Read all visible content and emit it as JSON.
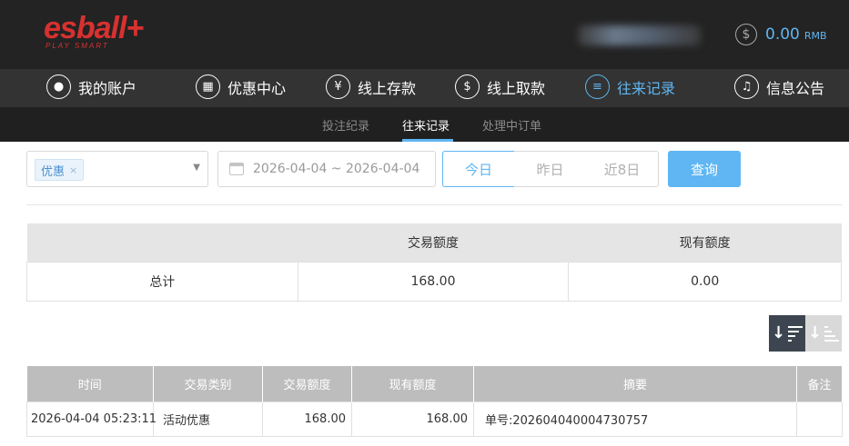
{
  "header": {
    "logo_main": "esball+",
    "logo_sub": "PLAY SMART",
    "balance_icon": "dollar-coin-icon",
    "balance_value": "0.00",
    "balance_currency": "RMB"
  },
  "nav": {
    "items": [
      {
        "label": "我的账户",
        "icon": "user-icon"
      },
      {
        "label": "优惠中心",
        "icon": "gift-icon"
      },
      {
        "label": "线上存款",
        "icon": "deposit-icon"
      },
      {
        "label": "线上取款",
        "icon": "withdraw-icon"
      },
      {
        "label": "往来记录",
        "icon": "records-icon"
      },
      {
        "label": "信息公告",
        "icon": "bell-icon"
      }
    ],
    "active_index": 4
  },
  "subnav": {
    "items": [
      "投注纪录",
      "往来记录",
      "处理中订单"
    ],
    "active_index": 1
  },
  "filter": {
    "type_tag": "优惠",
    "type_tag_remove": "×",
    "date_range": "2026-04-04 ~ 2026-04-04",
    "quick_ranges": [
      "今日",
      "昨日",
      "近8日"
    ],
    "active_range": 0,
    "query_label": "查询"
  },
  "summary": {
    "headers": [
      "",
      "交易额度",
      "现有额度"
    ],
    "row": [
      "总计",
      "168.00",
      "0.00"
    ]
  },
  "records": {
    "headers": [
      "时间",
      "交易类别",
      "交易额度",
      "现有额度",
      "摘要",
      "备注"
    ],
    "rows": [
      [
        "2026-04-04 05:23:11",
        "活动优惠",
        "168.00",
        "168.00",
        "单号:202604040004730757",
        ""
      ]
    ]
  },
  "colors": {
    "accent": "#5fb6f2",
    "brand": "#d8312f",
    "header_bg": "#232323",
    "nav_bg": "#333333"
  }
}
